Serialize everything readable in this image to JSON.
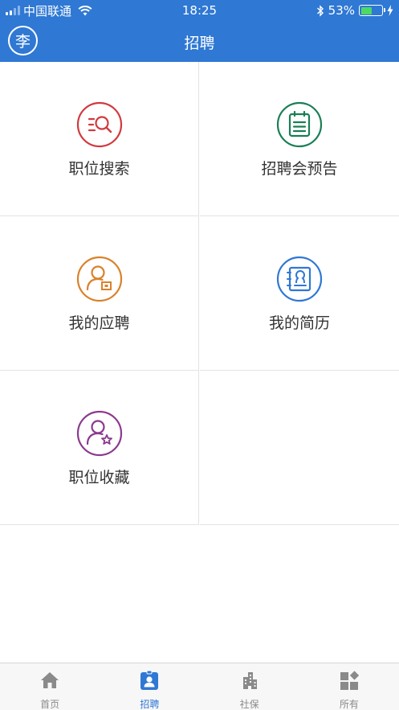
{
  "status_bar": {
    "carrier": "中国联通",
    "time": "18:25",
    "battery": "53%",
    "battery_level": 0.53
  },
  "header": {
    "avatar_text": "李",
    "title": "招聘"
  },
  "grid": [
    {
      "label": "职位搜索",
      "icon": "job-search-icon",
      "color": "#d13a3f"
    },
    {
      "label": "招聘会预告",
      "icon": "job-fair-notice-icon",
      "color": "#1a7f55"
    },
    {
      "label": "我的应聘",
      "icon": "my-applications-icon",
      "color": "#d9822b"
    },
    {
      "label": "我的简历",
      "icon": "my-resume-icon",
      "color": "#2f78d4"
    },
    {
      "label": "职位收藏",
      "icon": "favorite-jobs-icon",
      "color": "#8b3a8f"
    }
  ],
  "tabs": [
    {
      "label": "首页",
      "icon": "home-icon",
      "active": false
    },
    {
      "label": "招聘",
      "icon": "recruit-badge-icon",
      "active": true
    },
    {
      "label": "社保",
      "icon": "buildings-icon",
      "active": false
    },
    {
      "label": "所有",
      "icon": "all-apps-icon",
      "active": false
    }
  ],
  "colors": {
    "brand": "#2f78d4",
    "tab_inactive": "#8a8a8a"
  }
}
